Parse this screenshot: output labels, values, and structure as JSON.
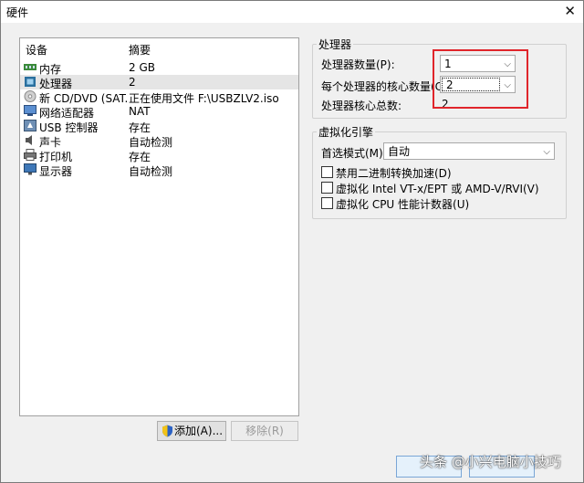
{
  "window": {
    "title": "硬件",
    "close_glyph": "✕"
  },
  "device_list": {
    "headers": {
      "device": "设备",
      "summary": "摘要"
    },
    "rows": [
      {
        "icon": "memory-icon",
        "name": "内存",
        "summary": "2 GB"
      },
      {
        "icon": "processor-icon",
        "name": "处理器",
        "summary": "2"
      },
      {
        "icon": "cd-dvd-icon",
        "name": "新 CD/DVD (SAT...",
        "summary": "正在使用文件 F:\\USBZLV2.iso"
      },
      {
        "icon": "network-adapter-icon",
        "name": "网络适配器",
        "summary": "NAT"
      },
      {
        "icon": "usb-controller-icon",
        "name": "USB 控制器",
        "summary": "存在"
      },
      {
        "icon": "sound-card-icon",
        "name": "声卡",
        "summary": "自动检测"
      },
      {
        "icon": "printer-icon",
        "name": "打印机",
        "summary": "存在"
      },
      {
        "icon": "display-icon",
        "name": "显示器",
        "summary": "自动检测"
      }
    ],
    "selected_index": 1
  },
  "buttons": {
    "add": "添加(A)...",
    "remove": "移除(R)"
  },
  "processor_group": {
    "title": "处理器",
    "count_label": "处理器数量(P):",
    "count_value": "1",
    "cores_label": "每个处理器的核心数量(C):",
    "cores_value": "2",
    "total_label": "处理器核心总数:",
    "total_value": "2"
  },
  "virtualization_group": {
    "title": "虚拟化引擎",
    "mode_label": "首选模式(M):",
    "mode_value": "自动",
    "options": [
      {
        "label": "禁用二进制转换加速(D)",
        "checked": false
      },
      {
        "label": "虚拟化 Intel VT-x/EPT 或 AMD-V/RVI(V)",
        "checked": false
      },
      {
        "label": "虚拟化 CPU 性能计数器(U)",
        "checked": false
      }
    ]
  },
  "colors": {
    "highlight": "#e0252b",
    "selected_row": "#e5e5e5",
    "window_bg": "#f0f0f0"
  },
  "watermark": "头条 @小兴电脑小技巧"
}
